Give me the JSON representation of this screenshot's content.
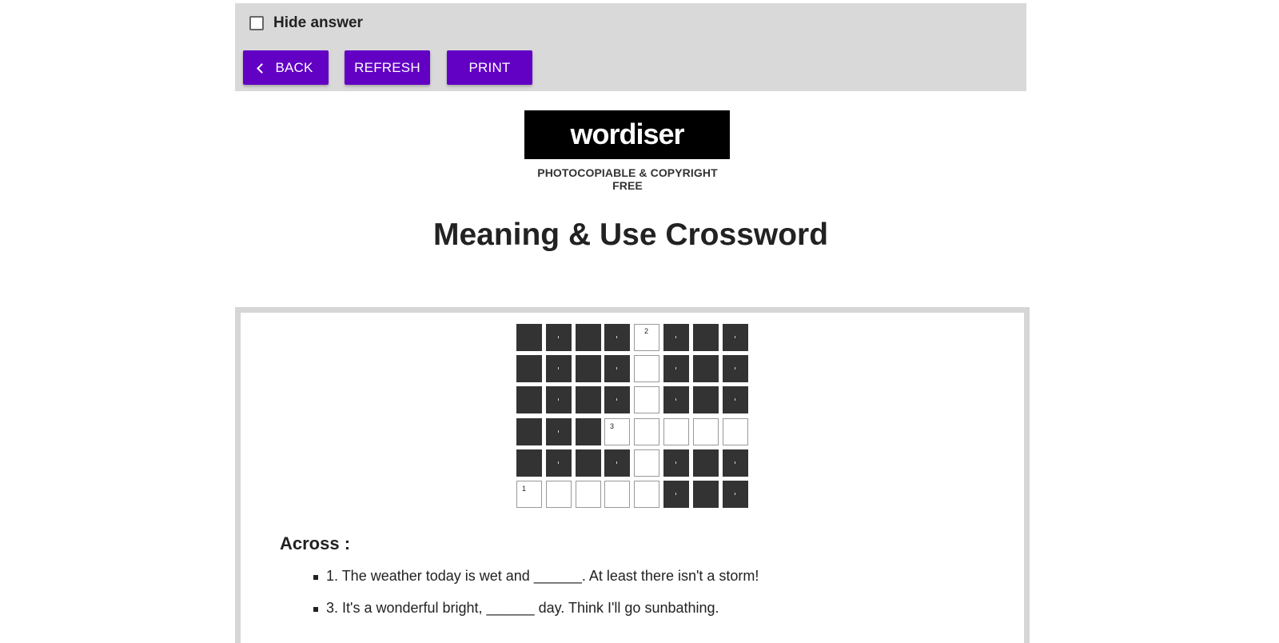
{
  "toolbar": {
    "hide_answer_label": "Hide answer",
    "back_label": "BACK",
    "refresh_label": "REFRESH",
    "print_label": "PRINT",
    "button_color": "#6200c4"
  },
  "brand": {
    "logo_text": "wordiser",
    "tagline": "PHOTOCOPIABLE & COPYRIGHT FREE"
  },
  "page": {
    "title": "Meaning & Use Crossword"
  },
  "crossword": {
    "rows": [
      "####.###",
      "####.###",
      "####.###",
      "###.....",
      "####.###",
      ".....###"
    ],
    "numbers": [
      {
        "row": 0,
        "col": 4,
        "n": "2"
      },
      {
        "row": 3,
        "col": 3,
        "n": "3"
      },
      {
        "row": 5,
        "col": 0,
        "n": "1"
      }
    ]
  },
  "clues": {
    "across_heading": "Across :",
    "across": [
      "1. The weather today is wet and ______. At least there isn't a storm!",
      "3. It's a wonderful bright, ______ day. Think I'll go sunbathing."
    ]
  }
}
